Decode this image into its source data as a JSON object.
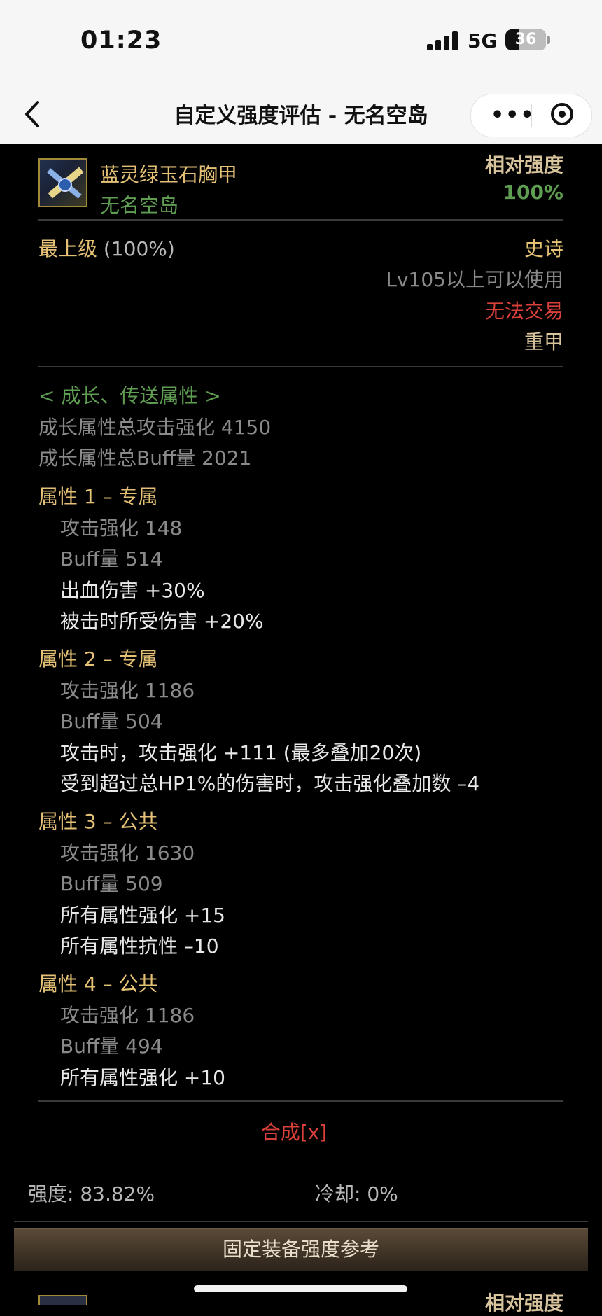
{
  "status_bar": {
    "time": "01:23",
    "network": "5G",
    "battery": "36"
  },
  "nav": {
    "title": "自定义强度评估 - 无名空岛"
  },
  "item": {
    "name": "蓝灵绿玉石胸甲",
    "set": "无名空岛",
    "relative_label": "相对强度",
    "relative_value": "100%",
    "grade_label": "最上级",
    "grade_pct": "(100%)",
    "rarity": "史诗",
    "level_req": "Lv105以上可以使用",
    "trade": "无法交易",
    "armor_type": "重甲"
  },
  "growth": {
    "header": "< 成长、传送属性 >",
    "total_atk": "成长属性总攻击强化 4150",
    "total_buff": "成长属性总Buff量 2021"
  },
  "attributes": [
    {
      "title": "属性 1 – 专属",
      "atk": "攻击强化  148",
      "buff": "Buff量  514",
      "effects": [
        "出血伤害 +30%",
        "被击时所受伤害 +20%"
      ]
    },
    {
      "title": "属性 2 – 专属",
      "atk": "攻击强化  1186",
      "buff": "Buff量  504",
      "effects": [
        "攻击时，攻击强化 +111 (最多叠加20次)",
        "受到超过总HP1%的伤害时，攻击强化叠加数 –4"
      ]
    },
    {
      "title": "属性 3 – 公共",
      "atk": "攻击强化  1630",
      "buff": "Buff量  509",
      "effects": [
        "所有属性强化 +15",
        "所有属性抗性 –10"
      ]
    },
    {
      "title": "属性 4 – 公共",
      "atk": "攻击强化  1186",
      "buff": "Buff量  494",
      "effects": [
        "所有属性强化 +10"
      ]
    }
  ],
  "compose": "合成[x]",
  "footer": {
    "strength": "强度: 83.82%",
    "cooldown": "冷却: 0%"
  },
  "banner": "固定装备强度参考",
  "next_item": {
    "relative_label": "相对强度"
  }
}
